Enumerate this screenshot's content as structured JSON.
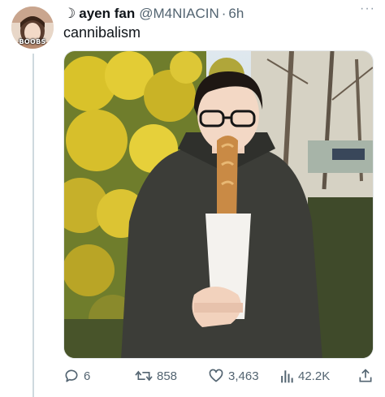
{
  "author": {
    "name_prefix": "☽",
    "display_name": "ayen fan",
    "handle": "@M4NIACIN",
    "separator": "·",
    "time": "6h",
    "avatar_caption": "BOOBS"
  },
  "tweet": {
    "text": "cannibalism"
  },
  "menu": {
    "more_icon": "···"
  },
  "media": {
    "type": "photo",
    "icon": "photo"
  },
  "metrics": {
    "replies": "6",
    "retweets": "858",
    "likes": "3,463",
    "views": "42.2K"
  },
  "icons": {
    "reply": "reply-icon",
    "retweet": "retweet-icon",
    "like": "heart-icon",
    "views": "analytics-icon",
    "share": "share-icon"
  },
  "colors": {
    "text": "#0f1419",
    "secondary": "#536471",
    "thread_line": "#cfd9de"
  }
}
